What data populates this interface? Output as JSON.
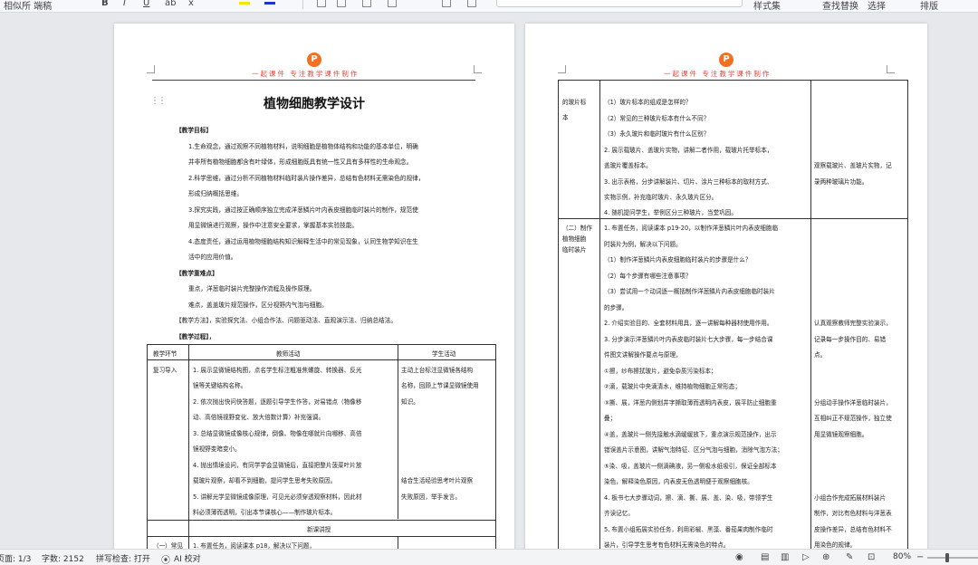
{
  "ribbon": {
    "items": [
      "相似所 端稿",
      "B",
      "I",
      "U",
      "ab",
      "x",
      "A",
      "样式集",
      "查找替换",
      "选择",
      "排版",
      "..."
    ]
  },
  "page1": {
    "header_text": "一起课件  专注教学课件制作",
    "logo_letter": "P",
    "title": "植物细胞教学设计",
    "lines": [
      "【教学目标】",
      "1.生命观念，通过观察不同植物材料，说明细胞是植物体结构和功能的基本单位，明确",
      "并非所有植物细胞都含有叶绿体，形成细胞既具有统一性又具有多样性的生命观念。",
      "2.科学思维，通过分析不同植物材料临时装片操作差异，总结有色材料无需染色的规律，",
      "形成归纳概括思维。",
      "3.探究实践，通过按正确顺序独立完成洋葱鳞片叶内表皮细胞临时装片的制作，规范使",
      "用显微镜进行观察，操作中注意安全要求，掌握基本实验技能。",
      "4.态度责任，通过运用植物细胞结构知识解释生活中的常见现象，认同生物学知识在生",
      "活中的应用价值。",
      "【教学重难点】",
      "重点，洋葱临时装片完整操作流程及操作原理。",
      "难点，盖盖玻片规范操作，区分视野内气泡与细胞。",
      "【教学方法】，实验探究法、小组合作法、问题驱动法、直观演示法、归纳总结法。",
      "【教学过程】，"
    ],
    "table": {
      "headers": [
        "教学环节",
        "教师活动",
        "学生活动"
      ],
      "row1": {
        "stage": "复习导入",
        "teacher": [
          "1. 展示显微镜结构图，点名学生标注粗准焦螺旋、转换器、反光",
          "镜等关键结构名称。",
          "2. 依次抛出快问快答题，逐题引导学生作答，对易错点（物像移",
          "动、高倍镜视野变化、放大倍数计算）补充强调。",
          "3. 总结显微镜成像核心规律，倒像、物像在哪就片向哪移、高倍",
          "镜视野变暗变小。",
          "4. 抛出情境设问，有同学学会显微镜后，直接把整片菠菜叶片放",
          "载玻片观察，却看不到细胞，提问学生思考失败原因。",
          "5. 讲解光学显微镜成像原理，可见光必须穿透观察材料，因此材",
          "料必须薄而透明，引出本节课核心——制作玻片标本。"
        ],
        "student_a": [
          "主动上台标注显微镜各结构",
          "名称，回顾上节课显微镜使用",
          "知识。"
        ],
        "student_b": [
          "结合生活经验思考叶片观察",
          "失败原因，举手发言。"
        ]
      },
      "section_label": "新课讲授",
      "row2": {
        "stage": "（一）常见",
        "teacher": "1. 布置任务，阅读课本 p18，解决以下问题，"
      }
    }
  },
  "page2": {
    "header_text": "一起课件  专注教学课件制作",
    "logo_letter": "P",
    "table": {
      "rowA": {
        "stage": [
          "的玻片标",
          "本"
        ],
        "teacher": [
          "（1）玻片标本的组成是怎样的？",
          "（2）常见的三种玻片标本有什么不同？",
          "（3）永久玻片和临时玻片有什么区别？",
          "2. 展示载玻片、盖玻片实物，讲解二者作用，载玻片托举标本，",
          "盖玻片覆盖标本。",
          "3. 出示表格，分步讲解装片、切片、涂片三种标本的取材方式、",
          "实物示例，补充临时玻片、永久玻片区分。",
          "4. 随机提问学生，举例区分三种玻片，当堂巩固。"
        ],
        "student": [
          "观察载玻片、盖玻片实物，记",
          "录两种玻璃片功能。"
        ]
      },
      "rowB": {
        "stage": [
          "（二）制作",
          "植物细胞",
          "临时装片"
        ],
        "teacher": [
          "1. 布置任务，阅读课本 p19-20，以制作洋葱鳞片叶内表皮细胞临",
          "时装片为例，解决以下问题。",
          "（1）制作洋葱鳞片内表皮细胞临时装片的步骤是什么？",
          "（2）每个步骤有哪些注意事项？",
          "（3）尝试用一个动词逐一概括制作洋葱鳞片内表皮细胞临时装片",
          "的步骤。",
          "2. 介绍实验目的、全套材料用具，逐一讲解每种器材使用作用。",
          "3. 分步演示洋葱鳞片叶内表皮临时装片七大步骤，每一步结合课",
          "件图文讲解操作要点与原理，",
          "①擦，纱布擦拭玻片，避免杂质污染标本；",
          "②滴，载玻片中央滴清水，维持植物细胞正常形态；",
          "③撕、展，洋葱内侧划井字撕取薄而透明内表皮，展平防止细胞重",
          "叠；",
          "④盖，盖玻片一侧先接触水滴缓缓放下，重点演示规范操作，出示",
          "错误盖片示意图，讲解气泡特征、区分气泡与细胞，消除气泡方法；",
          "⑤染、吸，盖玻片一侧滴碘液，另一侧吸水纸吸引，保证全部标本",
          "染色，解释染色原因，内表皮无色透明便于观察细胞核。",
          "4. 板书七大步骤动词，擦、滴、撕、展、盖、染、吸，带领学生",
          "齐读记忆。",
          "5. 布置小组拓展实验任务，利用彩椒、黑藻、番茄果肉制作临时",
          "装片，引导学生思考有色材料无需染色的特点。"
        ],
        "student_a": [
          "认真观察教师完整实验演示，",
          "记录每一步操作目的、易错",
          "点。"
        ],
        "student_b": [
          "分组动手操作洋葱临时装片，",
          "互相纠正不规范操作，独立使",
          "用显微镜观察细胞。"
        ],
        "student_c": [
          "小组合作完成拓展材料装片",
          "制作，对比有色材料与洋葱表",
          "皮操作差异，总结有色材料不",
          "用染色的规律。"
        ]
      }
    }
  },
  "status": {
    "page": "页面: 1/3",
    "words": "字数: 2152",
    "spell": "拼写检查: 打开",
    "ai": "AI 校对",
    "zoom": "80%"
  }
}
